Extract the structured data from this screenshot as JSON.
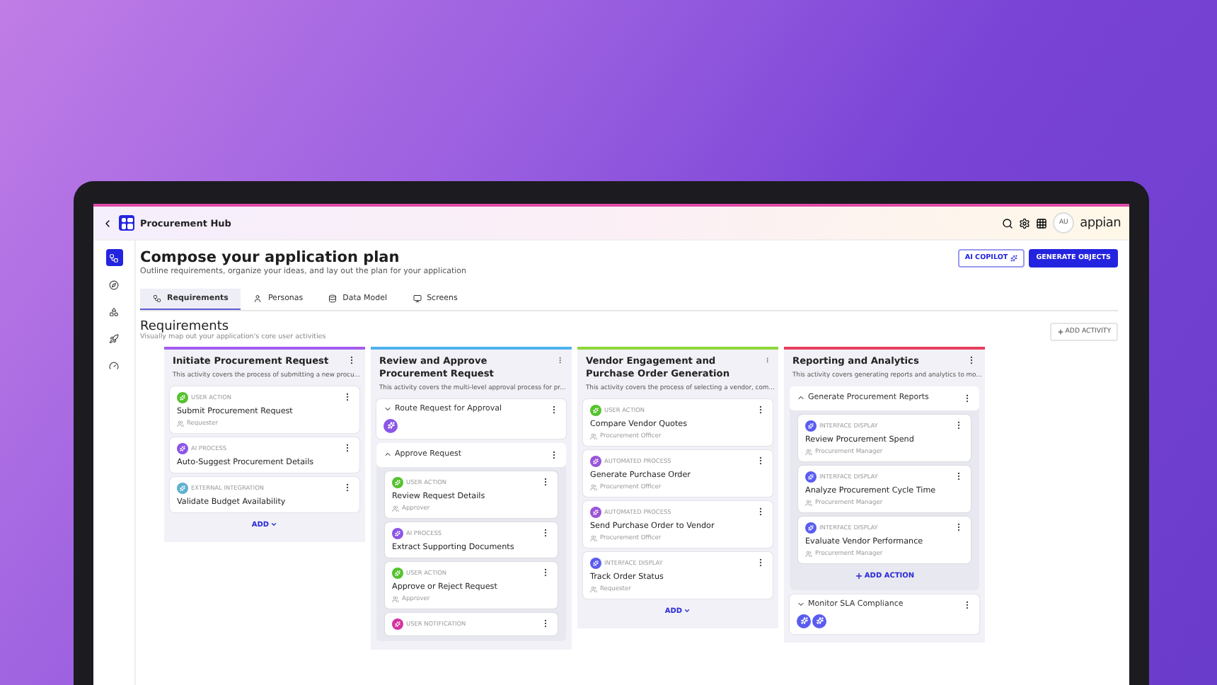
{
  "topbar": {
    "title": "Procurement Hub",
    "avatar": "AU",
    "brand": "appian"
  },
  "rail": [
    {
      "selected": true
    },
    {
      "selected": false
    },
    {
      "selected": false
    },
    {
      "selected": false
    },
    {
      "selected": false
    }
  ],
  "header": {
    "title": "Compose your application plan",
    "subtitle": "Outline requirements, organize your ideas, and lay out the plan for your application",
    "buttons": [
      {
        "label": "AI COPILOT",
        "kind": "outline"
      },
      {
        "label": "GENERATE OBJECTS",
        "kind": "primary"
      }
    ]
  },
  "tabs": [
    {
      "label": "Requirements",
      "selected": true
    },
    {
      "label": "Personas",
      "selected": false
    },
    {
      "label": "Data Model",
      "selected": false
    },
    {
      "label": "Screens",
      "selected": false
    }
  ],
  "section": {
    "title": "Requirements",
    "subtitle": "Visually map out your application's core user activities",
    "add": "ADD ACTIVITY"
  },
  "activities": [
    {
      "title": "Initiate Procurement Request",
      "description": "This activity covers the process of submitting a new procu...",
      "color": "#a35cf0",
      "add": "ADD",
      "items": [
        {
          "kind": "action",
          "type": "USER ACTION",
          "color": "#55c22e",
          "name": "Submit Procurement Request",
          "persona": "Requester"
        },
        {
          "kind": "action",
          "type": "AI PROCESS",
          "color": "#8b55e6",
          "name": "Auto-Suggest Procurement Details"
        },
        {
          "kind": "action",
          "type": "EXTERNAL INTEGRATION",
          "color": "#5fb0cf",
          "name": "Validate Budget Availability"
        }
      ]
    },
    {
      "title": "Review and Approve Procurement Request",
      "description": "This activity covers the multi-level approval process for pr...",
      "color": "#4fb2f0",
      "items": [
        {
          "kind": "group",
          "name": "Route Request for Approval",
          "expanded": false,
          "chips": [
            {
              "color": "#8b55e6"
            }
          ]
        },
        {
          "kind": "group",
          "name": "Approve Request",
          "expanded": true,
          "children": [
            {
              "kind": "action",
              "type": "USER ACTION",
              "color": "#55c22e",
              "name": "Review Request Details",
              "persona": "Approver"
            },
            {
              "kind": "action",
              "type": "AI PROCESS",
              "color": "#8b55e6",
              "name": "Extract Supporting Documents"
            },
            {
              "kind": "action",
              "type": "USER ACTION",
              "color": "#55c22e",
              "name": "Approve or Reject Request",
              "persona": "Approver"
            },
            {
              "kind": "action",
              "type": "USER NOTIFICATION",
              "color": "#d4329f"
            }
          ]
        }
      ]
    },
    {
      "title": "Vendor Engagement and Purchase Order Generation",
      "description": "This activity covers the process of selecting a vendor, com...",
      "color": "#8fd63a",
      "add": "ADD",
      "items": [
        {
          "kind": "action",
          "type": "USER ACTION",
          "color": "#55c22e",
          "name": "Compare Vendor Quotes",
          "persona": "Procurement Officer"
        },
        {
          "kind": "action",
          "type": "AUTOMATED PROCESS",
          "color": "#9a55d8",
          "name": "Generate Purchase Order",
          "persona": "Procurement Officer"
        },
        {
          "kind": "action",
          "type": "AUTOMATED PROCESS",
          "color": "#9a55d8",
          "name": "Send Purchase Order to Vendor",
          "persona": "Procurement Officer"
        },
        {
          "kind": "action",
          "type": "INTERFACE DISPLAY",
          "color": "#5a5cf0",
          "name": "Track Order Status",
          "persona": "Requester"
        }
      ]
    },
    {
      "title": "Reporting and Analytics",
      "description": "This activity covers generating reports and analytics to mo...",
      "color": "#e8405e",
      "items": [
        {
          "kind": "group",
          "name": "Generate Procurement Reports",
          "expanded": true,
          "add": "ADD ACTION",
          "children": [
            {
              "kind": "action",
              "type": "INTERFACE DISPLAY",
              "color": "#5a5cf0",
              "name": "Review Procurement Spend",
              "persona": "Procurement Manager"
            },
            {
              "kind": "action",
              "type": "INTERFACE DISPLAY",
              "color": "#5a5cf0",
              "name": "Analyze Procurement Cycle Time",
              "persona": "Procurement Manager"
            },
            {
              "kind": "action",
              "type": "INTERFACE DISPLAY",
              "color": "#5a5cf0",
              "name": "Evaluate Vendor Performance",
              "persona": "Procurement Manager"
            }
          ]
        },
        {
          "kind": "group",
          "name": "Monitor SLA Compliance",
          "expanded": false,
          "chips": [
            {
              "color": "#5a5cf0"
            },
            {
              "color": "#5a5cf0"
            }
          ]
        }
      ]
    }
  ]
}
